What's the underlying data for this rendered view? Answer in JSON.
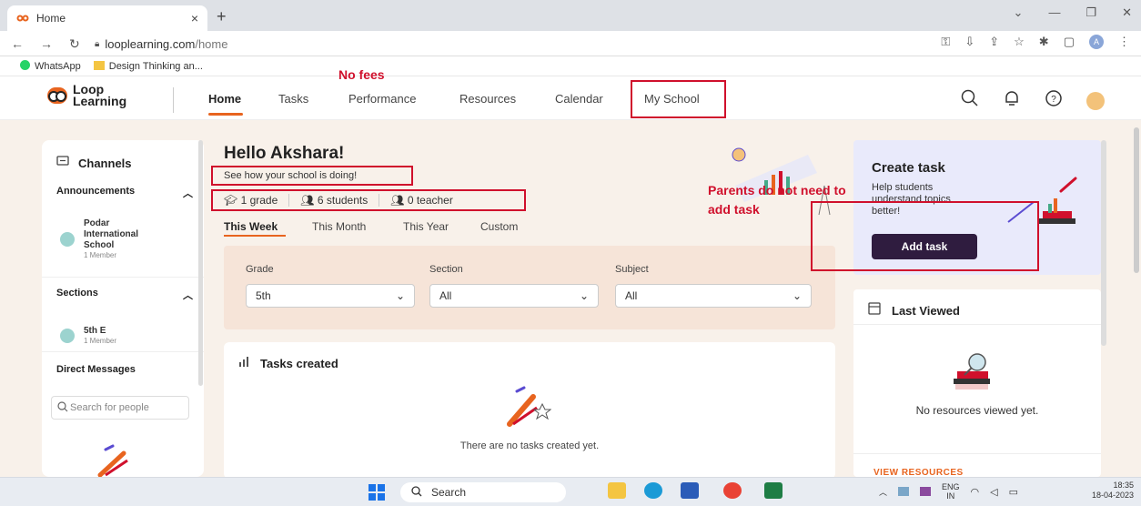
{
  "browser": {
    "tab_title": "Home",
    "url_host": "looplearning.com",
    "url_path": "/home",
    "new_tab": "+",
    "close": "×",
    "bookmarks": [
      "WhatsApp",
      "Design Thinking an..."
    ]
  },
  "app": {
    "logo_line1": "Loop",
    "logo_line2": "Learning",
    "nav": [
      "Home",
      "Tasks",
      "Performance",
      "Resources",
      "Calendar",
      "My School"
    ]
  },
  "annotations": {
    "no_fees": "No fees",
    "parents_line1": "Parents do not need to",
    "parents_line2": "add task"
  },
  "sidebar": {
    "channels": "Channels",
    "announcements": "Announcements",
    "school_name": "Podar International School",
    "school_members": "1 Member",
    "sections": "Sections",
    "section_name": "5th E",
    "section_members": "1 Member",
    "direct_messages": "Direct Messages",
    "search_placeholder": "Search for people"
  },
  "main": {
    "greeting": "Hello Akshara!",
    "subtitle": "See how your school is doing!",
    "stats": [
      "1 grade",
      "6 students",
      "0 teacher"
    ],
    "tabs": [
      "This Week",
      "This Month",
      "This Year",
      "Custom"
    ],
    "filters": [
      {
        "label": "Grade",
        "value": "5th"
      },
      {
        "label": "Section",
        "value": "All"
      },
      {
        "label": "Subject",
        "value": "All"
      }
    ],
    "tasks_title": "Tasks created",
    "tasks_empty": "There are no tasks created yet."
  },
  "right": {
    "create_title": "Create task",
    "create_desc_l1": "Help students",
    "create_desc_l2": "understand topics",
    "create_desc_l3": "better!",
    "add_task": "Add task",
    "last_viewed": "Last Viewed",
    "no_resources": "No resources viewed yet.",
    "view_resources": "VIEW RESOURCES"
  },
  "taskbar": {
    "search": "Search",
    "lang1": "ENG",
    "lang2": "IN",
    "time": "18:35",
    "date": "18-04-2023"
  },
  "colors": {
    "accent": "#e8641f",
    "annotation_red": "#d0102c",
    "add_task_bg": "#2f1c3f",
    "page_bg": "#f8f1ea"
  }
}
